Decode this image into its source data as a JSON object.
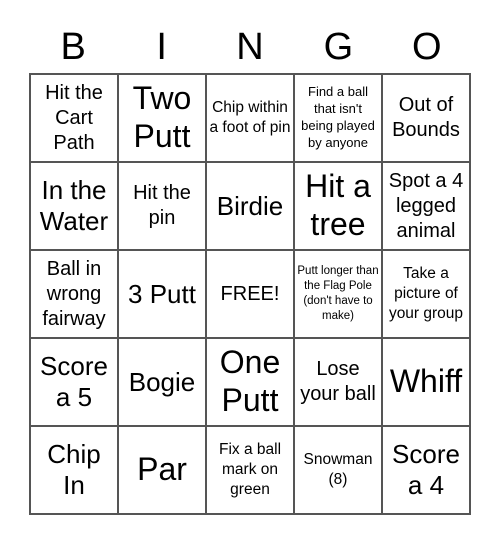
{
  "header": [
    "B",
    "I",
    "N",
    "G",
    "O"
  ],
  "cells": [
    {
      "text": "Hit the Cart Path",
      "size": "s-m"
    },
    {
      "text": "Two Putt",
      "size": "s-xl"
    },
    {
      "text": "Chip within a foot of pin",
      "size": "s-s"
    },
    {
      "text": "Find a ball that isn't being played by anyone",
      "size": "s-xs"
    },
    {
      "text": "Out of Bounds",
      "size": "s-m"
    },
    {
      "text": "In the Water",
      "size": "s-l"
    },
    {
      "text": "Hit the pin",
      "size": "s-m"
    },
    {
      "text": "Birdie",
      "size": "s-l"
    },
    {
      "text": "Hit a tree",
      "size": "s-xl"
    },
    {
      "text": "Spot a 4 legged animal",
      "size": "s-m"
    },
    {
      "text": "Ball in wrong fairway",
      "size": "s-m"
    },
    {
      "text": "3 Putt",
      "size": "s-l"
    },
    {
      "text": "FREE!",
      "size": "s-m"
    },
    {
      "text": "Putt longer than the Flag Pole (don't have to make)",
      "size": "s-xxs"
    },
    {
      "text": "Take a picture of your group",
      "size": "s-s"
    },
    {
      "text": "Score a 5",
      "size": "s-l"
    },
    {
      "text": "Bogie",
      "size": "s-l"
    },
    {
      "text": "One Putt",
      "size": "s-xl"
    },
    {
      "text": "Lose your ball",
      "size": "s-m"
    },
    {
      "text": "Whiff",
      "size": "s-xl"
    },
    {
      "text": "Chip In",
      "size": "s-l"
    },
    {
      "text": "Par",
      "size": "s-xl"
    },
    {
      "text": "Fix a ball mark on green",
      "size": "s-s"
    },
    {
      "text": "Snowman (8)",
      "size": "s-s"
    },
    {
      "text": "Score a 4",
      "size": "s-l"
    }
  ]
}
